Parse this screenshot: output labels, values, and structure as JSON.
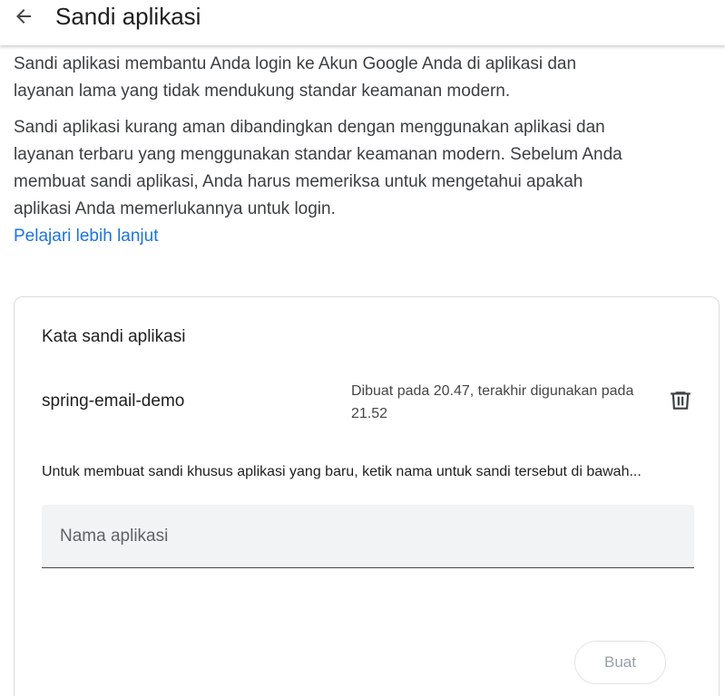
{
  "header": {
    "back_icon": "arrow-left-icon",
    "title": "Sandi aplikasi"
  },
  "intro": {
    "paragraph1": "Sandi aplikasi membantu Anda login ke Akun Google Anda di aplikasi dan layanan lama yang tidak mendukung standar keamanan modern.",
    "paragraph2": "Sandi aplikasi kurang aman dibandingkan dengan menggunakan aplikasi dan layanan terbaru yang menggunakan standar keamanan modern. Sebelum Anda membuat sandi aplikasi, Anda harus memeriksa untuk mengetahui apakah aplikasi Anda memerlukannya untuk login.",
    "learn_more": "Pelajari lebih lanjut"
  },
  "card": {
    "title": "Kata sandi aplikasi",
    "passwords": [
      {
        "name": "spring-email-demo",
        "meta": "Dibuat pada 20.47, terakhir digunakan pada 21.52",
        "delete_icon": "trash-icon"
      }
    ],
    "hint": "Untuk membuat sandi khusus aplikasi yang baru, ketik nama untuk sandi tersebut di bawah...",
    "input": {
      "placeholder": "Nama aplikasi",
      "value": ""
    },
    "create_label": "Buat"
  },
  "colors": {
    "link": "#1a73e8",
    "text": "#1f1f1f",
    "border": "#dadce0",
    "input_bg": "#f1f3f4",
    "disabled_text": "#9aa0a6"
  }
}
